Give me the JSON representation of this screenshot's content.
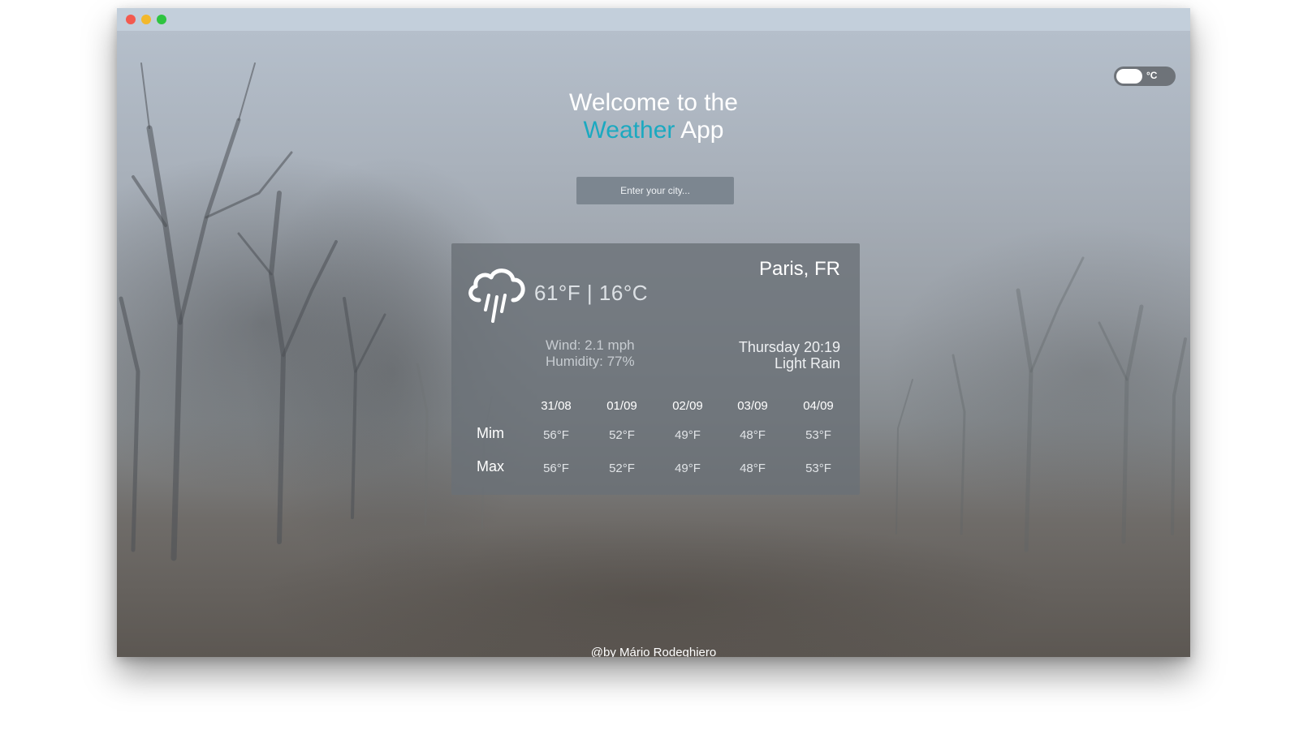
{
  "header": {
    "line1": "Welcome to the",
    "accent_word": "Weather",
    "rest_word": "App"
  },
  "unit_toggle": {
    "label": "°C",
    "on": true
  },
  "search": {
    "placeholder": "Enter your city..."
  },
  "current": {
    "icon": "cloud-rain-icon",
    "temperature": "61°F | 16°C",
    "location": "Paris, FR",
    "wind": "Wind: 2.1 mph",
    "humidity": "Humidity: 77%",
    "datetime": "Thursday 20:19",
    "condition": "Light Rain"
  },
  "forecast": {
    "dates": [
      "31/08",
      "01/09",
      "02/09",
      "03/09",
      "04/09"
    ],
    "min_label": "Mim",
    "max_label": "Max",
    "min": [
      "56°F",
      "52°F",
      "49°F",
      "48°F",
      "53°F"
    ],
    "max": [
      "56°F",
      "52°F",
      "49°F",
      "48°F",
      "53°F"
    ]
  },
  "footer": {
    "credit": "@by Mário Rodeghiero"
  },
  "colors": {
    "accent": "#1ba9c0",
    "titlebar": "#c3cfdb",
    "card": "#6a7077",
    "close": "#f35a4f",
    "minimize": "#f2b82c",
    "maximize": "#2ec440"
  }
}
